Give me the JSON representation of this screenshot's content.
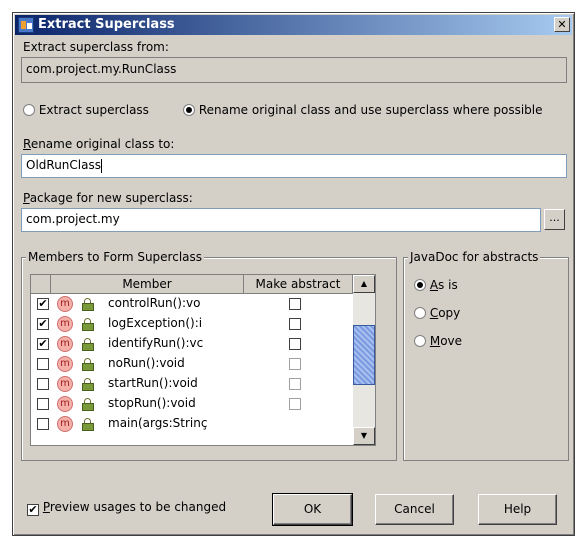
{
  "window": {
    "title": "Extract Superclass",
    "close_glyph": "✕"
  },
  "extract_from": {
    "label": "Extract superclass from:",
    "value": "com.project.my.RunClass"
  },
  "mode": {
    "options": [
      {
        "label": "Extract superclass",
        "selected": false
      },
      {
        "label": "Rename original class and use superclass where possible",
        "selected": true
      }
    ]
  },
  "rename": {
    "label_first": "R",
    "label_rest": "ename original class to:",
    "value": "OldRunClass"
  },
  "package": {
    "label_first": "P",
    "label_rest": "ackage for new superclass:",
    "value": "com.project.my",
    "browse_label": "..."
  },
  "members": {
    "group_title": "Members to Form Superclass",
    "columns": [
      "Member",
      "Make abstract"
    ],
    "rows": [
      {
        "checked": true,
        "name": "controlRun():vo",
        "icon": "method-icon",
        "abstract": false
      },
      {
        "checked": true,
        "name": "logException():i",
        "icon": "method-icon",
        "abstract": false
      },
      {
        "checked": true,
        "name": "identifyRun():vc",
        "icon": "method-icon",
        "abstract": false
      },
      {
        "checked": false,
        "name": "noRun():void",
        "icon": "method-icon",
        "abstract": false
      },
      {
        "checked": false,
        "name": "startRun():void",
        "icon": "method-icon",
        "abstract": false
      },
      {
        "checked": false,
        "name": "stopRun():void",
        "icon": "method-icon",
        "abstract": false
      },
      {
        "checked": false,
        "name": "main(args:Strinç",
        "icon": "static-method-icon",
        "abstract": false
      }
    ]
  },
  "javadoc": {
    "group_title": "JavaDoc for abstracts",
    "options": [
      {
        "first": "A",
        "rest": "s is",
        "selected": true
      },
      {
        "first": "C",
        "rest": "opy",
        "selected": false
      },
      {
        "first": "M",
        "rest": "ove",
        "selected": false
      }
    ]
  },
  "preview": {
    "first": "P",
    "rest": "review usages to be changed",
    "checked": true
  },
  "buttons": {
    "ok": "OK",
    "cancel": "Cancel",
    "help": "Help"
  },
  "colors": {
    "title_start": "#0a246a",
    "title_end": "#a6caf0",
    "face": "#d4d0c8"
  }
}
